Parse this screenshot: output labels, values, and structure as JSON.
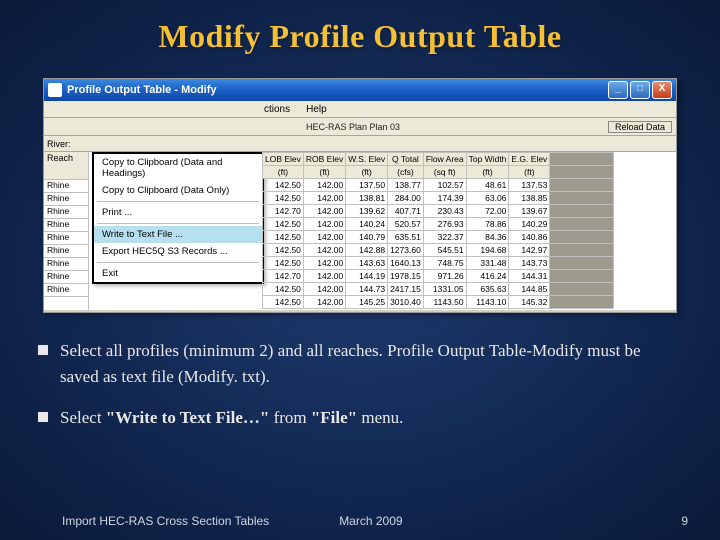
{
  "slide": {
    "title": "Modify Profile Output Table"
  },
  "window": {
    "title": "Profile Output Table - Modify",
    "menubar": {
      "item_partial": "ctions",
      "help": "Help"
    },
    "plan_label": "HEC-RAS  Plan  Plan 03",
    "reload_btn": "Reload Data",
    "river_label": "River:",
    "left_col_hdr": "Reach",
    "left_cells": [
      "Rhine",
      "Rhine",
      "Rhine",
      "Rhine",
      "Rhine",
      "Rhine",
      "Rhine",
      "Rhine",
      "Rhine"
    ]
  },
  "menu": {
    "items": [
      "Copy to Clipboard (Data and Headings)",
      "Copy to Clipboard (Data Only)",
      "Print ...",
      "Write to Text File ...",
      "Export HEC5Q S3 Records ...",
      "Exit"
    ]
  },
  "table": {
    "headers": [
      "LOB Elev",
      "ROB Elev",
      "W.S. Elev",
      "Q Total",
      "Flow Area",
      "Top Width",
      "E.G. Elev"
    ],
    "units": [
      "(ft)",
      "(ft)",
      "(ft)",
      "(cfs)",
      "(sq ft)",
      "(ft)",
      "(ft)"
    ],
    "rows": [
      [
        "142.50",
        "142.00",
        "137.50",
        "138.77",
        "102.57",
        "48.61",
        "137.53"
      ],
      [
        "142.50",
        "142.00",
        "138.81",
        "284.00",
        "174.39",
        "63.06",
        "138.85"
      ],
      [
        "142.70",
        "142.00",
        "139.62",
        "407.71",
        "230.43",
        "72.00",
        "139.67"
      ],
      [
        "142.50",
        "142.00",
        "140.24",
        "520.57",
        "276.93",
        "78.86",
        "140.29"
      ],
      [
        "142.50",
        "142.00",
        "140.79",
        "635.51",
        "322.37",
        "84.36",
        "140.86"
      ],
      [
        "142.50",
        "142.00",
        "142.88",
        "1273.60",
        "545.51",
        "194.68",
        "142.97"
      ],
      [
        "142.50",
        "142.00",
        "143.63",
        "1640.13",
        "748.75",
        "331.48",
        "143.73"
      ],
      [
        "142.70",
        "142.00",
        "144.19",
        "1978.15",
        "971.26",
        "416.24",
        "144.31"
      ],
      [
        "142.50",
        "142.00",
        "144.73",
        "2417.15",
        "1331.05",
        "635.63",
        "144.85"
      ],
      [
        "142.50",
        "142.00",
        "145.25",
        "3010.40",
        "1143.50",
        "1143.10",
        "145.32"
      ]
    ]
  },
  "bullets": [
    {
      "pre": "Select all profiles (minimum 2) and all reaches.  Profile Output Table-Modify must be saved as text file (Modify. txt)."
    },
    {
      "pre": "Select ",
      "b1": "\"Write to Text File…\"",
      "mid": " from ",
      "b2": "\"File\"",
      "post": " menu."
    }
  ],
  "footer": {
    "left": "Import HEC-RAS Cross Section Tables",
    "center": "March 2009",
    "page": "9"
  }
}
